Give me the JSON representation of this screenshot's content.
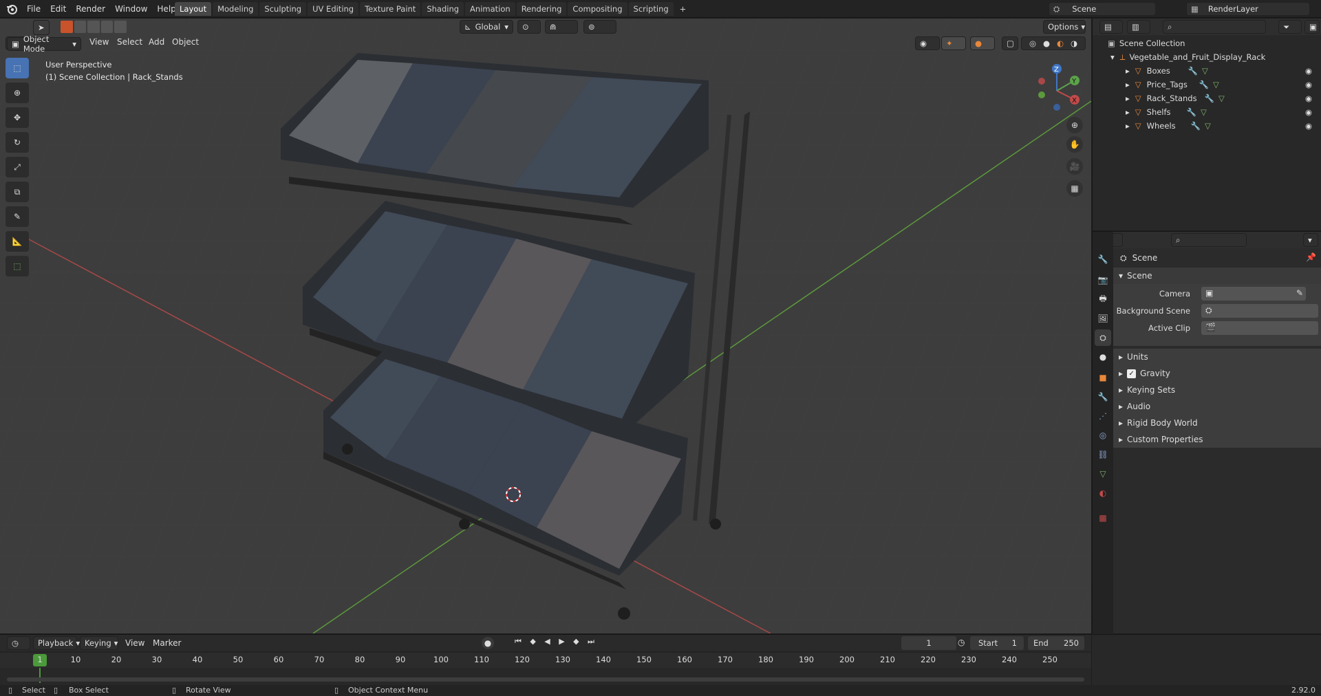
{
  "app": {
    "version": "2.92.0"
  },
  "menu": [
    "File",
    "Edit",
    "Render",
    "Window",
    "Help"
  ],
  "workspaces": [
    {
      "label": "Layout",
      "active": true
    },
    {
      "label": "Modeling",
      "active": false
    },
    {
      "label": "Sculpting",
      "active": false
    },
    {
      "label": "UV Editing",
      "active": false
    },
    {
      "label": "Texture Paint",
      "active": false
    },
    {
      "label": "Shading",
      "active": false
    },
    {
      "label": "Animation",
      "active": false
    },
    {
      "label": "Rendering",
      "active": false
    },
    {
      "label": "Compositing",
      "active": false
    },
    {
      "label": "Scripting",
      "active": false
    }
  ],
  "top_right": {
    "scene": "Scene",
    "render_layer": "RenderLayer"
  },
  "viewport_header": {
    "mode": "Object Mode",
    "menus": [
      "View",
      "Select",
      "Add",
      "Object"
    ],
    "transform_orientation": "Global",
    "options": "Options"
  },
  "viewport_overlay": {
    "perspective": "User Perspective",
    "collection_info": "(1) Scene Collection | Rack_Stands"
  },
  "outliner": {
    "root": "Scene Collection",
    "collection": "Vegetable_and_Fruit_Display_Rack",
    "items": [
      "Boxes",
      "Price_Tags",
      "Rack_Stands",
      "Shelfs",
      "Wheels"
    ]
  },
  "properties": {
    "header": "Scene",
    "section": "Scene",
    "fields": [
      {
        "label": "Camera"
      },
      {
        "label": "Background Scene"
      },
      {
        "label": "Active Clip"
      }
    ],
    "subpanels": [
      "Units",
      "Gravity",
      "Keying Sets",
      "Audio",
      "Rigid Body World",
      "Custom Properties"
    ],
    "gravity_checked": true
  },
  "timeline": {
    "menus": [
      "Playback",
      "Keying",
      "View",
      "Marker"
    ],
    "current_frame": "1",
    "start_label": "Start",
    "start": "1",
    "end_label": "End",
    "end": "250",
    "ruler": [
      "1",
      "10",
      "20",
      "30",
      "40",
      "50",
      "60",
      "70",
      "80",
      "90",
      "100",
      "110",
      "120",
      "130",
      "140",
      "150",
      "160",
      "170",
      "180",
      "190",
      "200",
      "210",
      "220",
      "230",
      "240",
      "250"
    ]
  },
  "statusbar": {
    "select": "Select",
    "box_select": "Box Select",
    "rotate_view": "Rotate View",
    "context_menu": "Object Context Menu"
  },
  "colors": {
    "accent": "#4772b3",
    "x_axis": "#c24a4a",
    "y_axis": "#5ca34a",
    "z_axis": "#3f77c9",
    "object_orange": "#e8873a"
  }
}
